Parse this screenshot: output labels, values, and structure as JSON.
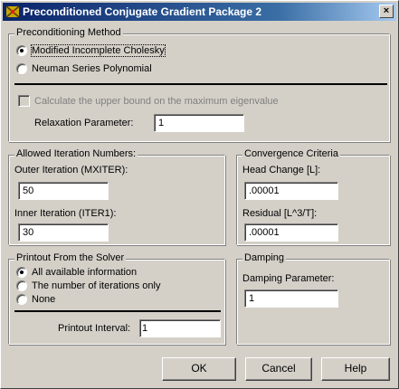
{
  "window": {
    "title": "Preconditioned Conjugate Gradient Package 2",
    "close_symbol": "×"
  },
  "method": {
    "legend": "Preconditioning Method",
    "options": [
      {
        "label": "Modified Incomplete Cholesky",
        "checked": true
      },
      {
        "label": "Neuman Series Polynomial",
        "checked": false
      }
    ],
    "upper_bound_checkbox": "Calculate the upper bound on the maximum eigenvalue",
    "relaxation_label": "Relaxation Parameter:",
    "relaxation_value": "1"
  },
  "iterations": {
    "legend": "Allowed Iteration Numbers:",
    "outer_label": "Outer Iteration (MXITER):",
    "outer_value": "50",
    "inner_label": "Inner Iteration (ITER1):",
    "inner_value": "30"
  },
  "convergence": {
    "legend": "Convergence Criteria",
    "head_label": "Head Change [L]:",
    "head_value": ".00001",
    "residual_label": "Residual [L^3/T]:",
    "residual_value": ".00001"
  },
  "printout": {
    "legend": "Printout From the Solver",
    "options": [
      {
        "label": "All available information",
        "checked": true
      },
      {
        "label": "The number of iterations only",
        "checked": false
      },
      {
        "label": "None",
        "checked": false
      }
    ],
    "interval_label": "Printout Interval:",
    "interval_value": "1"
  },
  "damping": {
    "legend": "Damping",
    "param_label": "Damping Parameter:",
    "param_value": "1"
  },
  "buttons": {
    "ok": "OK",
    "cancel": "Cancel",
    "help": "Help"
  }
}
